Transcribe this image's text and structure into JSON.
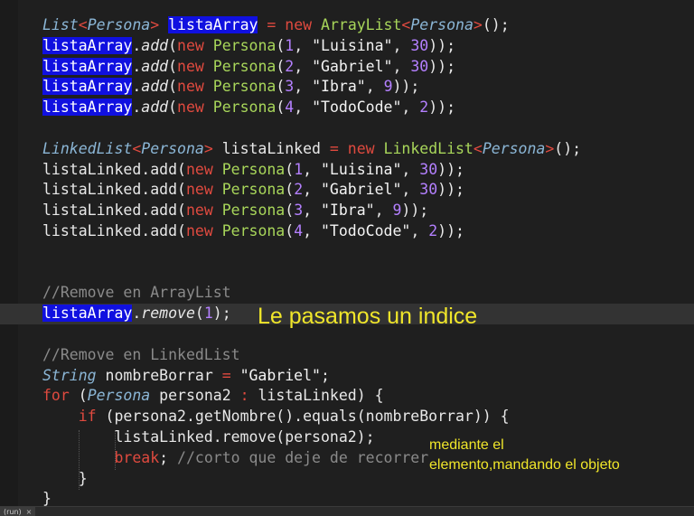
{
  "editor": {
    "highlight_color": "#1010e0",
    "lines": [
      [
        {
          "t": "List",
          "c": "type"
        },
        {
          "t": "<",
          "c": "op"
        },
        {
          "t": "Persona",
          "c": "type"
        },
        {
          "t": ">",
          "c": "op"
        },
        {
          "t": " ",
          "c": "plain"
        },
        {
          "t": "listaArray",
          "c": "hl"
        },
        {
          "t": " ",
          "c": "plain"
        },
        {
          "t": "=",
          "c": "op"
        },
        {
          "t": " ",
          "c": "plain"
        },
        {
          "t": "new",
          "c": "kw"
        },
        {
          "t": " ",
          "c": "plain"
        },
        {
          "t": "ArrayList",
          "c": "cls"
        },
        {
          "t": "<",
          "c": "op"
        },
        {
          "t": "Persona",
          "c": "type"
        },
        {
          "t": ">",
          "c": "op"
        },
        {
          "t": "();",
          "c": "plain"
        }
      ],
      [
        {
          "t": "listaArray",
          "c": "hl"
        },
        {
          "t": ".",
          "c": "plain"
        },
        {
          "t": "add",
          "c": "fn"
        },
        {
          "t": "(",
          "c": "plain"
        },
        {
          "t": "new",
          "c": "kw"
        },
        {
          "t": " ",
          "c": "plain"
        },
        {
          "t": "Persona",
          "c": "cls"
        },
        {
          "t": "(",
          "c": "plain"
        },
        {
          "t": "1",
          "c": "num"
        },
        {
          "t": ", ",
          "c": "plain"
        },
        {
          "t": "\"Luisina\"",
          "c": "str"
        },
        {
          "t": ", ",
          "c": "plain"
        },
        {
          "t": "30",
          "c": "num"
        },
        {
          "t": "));",
          "c": "plain"
        }
      ],
      [
        {
          "t": "listaArray",
          "c": "hl"
        },
        {
          "t": ".",
          "c": "plain"
        },
        {
          "t": "add",
          "c": "fn"
        },
        {
          "t": "(",
          "c": "plain"
        },
        {
          "t": "new",
          "c": "kw"
        },
        {
          "t": " ",
          "c": "plain"
        },
        {
          "t": "Persona",
          "c": "cls"
        },
        {
          "t": "(",
          "c": "plain"
        },
        {
          "t": "2",
          "c": "num"
        },
        {
          "t": ", ",
          "c": "plain"
        },
        {
          "t": "\"Gabriel\"",
          "c": "str"
        },
        {
          "t": ", ",
          "c": "plain"
        },
        {
          "t": "30",
          "c": "num"
        },
        {
          "t": "));",
          "c": "plain"
        }
      ],
      [
        {
          "t": "listaArray",
          "c": "hl"
        },
        {
          "t": ".",
          "c": "plain"
        },
        {
          "t": "add",
          "c": "fn"
        },
        {
          "t": "(",
          "c": "plain"
        },
        {
          "t": "new",
          "c": "kw"
        },
        {
          "t": " ",
          "c": "plain"
        },
        {
          "t": "Persona",
          "c": "cls"
        },
        {
          "t": "(",
          "c": "plain"
        },
        {
          "t": "3",
          "c": "num"
        },
        {
          "t": ", ",
          "c": "plain"
        },
        {
          "t": "\"Ibra\"",
          "c": "str"
        },
        {
          "t": ", ",
          "c": "plain"
        },
        {
          "t": "9",
          "c": "num"
        },
        {
          "t": "));",
          "c": "plain"
        }
      ],
      [
        {
          "t": "listaArray",
          "c": "hl"
        },
        {
          "t": ".",
          "c": "plain"
        },
        {
          "t": "add",
          "c": "fn"
        },
        {
          "t": "(",
          "c": "plain"
        },
        {
          "t": "new",
          "c": "kw"
        },
        {
          "t": " ",
          "c": "plain"
        },
        {
          "t": "Persona",
          "c": "cls"
        },
        {
          "t": "(",
          "c": "plain"
        },
        {
          "t": "4",
          "c": "num"
        },
        {
          "t": ", ",
          "c": "plain"
        },
        {
          "t": "\"TodoCode\"",
          "c": "str"
        },
        {
          "t": ", ",
          "c": "plain"
        },
        {
          "t": "2",
          "c": "num"
        },
        {
          "t": "));",
          "c": "plain"
        }
      ],
      [],
      [
        {
          "t": "LinkedList",
          "c": "type"
        },
        {
          "t": "<",
          "c": "op"
        },
        {
          "t": "Persona",
          "c": "type"
        },
        {
          "t": ">",
          "c": "op"
        },
        {
          "t": " listaLinked ",
          "c": "plain"
        },
        {
          "t": "=",
          "c": "op"
        },
        {
          "t": " ",
          "c": "plain"
        },
        {
          "t": "new",
          "c": "kw"
        },
        {
          "t": " ",
          "c": "plain"
        },
        {
          "t": "LinkedList",
          "c": "cls"
        },
        {
          "t": "<",
          "c": "op"
        },
        {
          "t": "Persona",
          "c": "type"
        },
        {
          "t": ">",
          "c": "op"
        },
        {
          "t": "();",
          "c": "plain"
        }
      ],
      [
        {
          "t": "listaLinked.add(",
          "c": "plain"
        },
        {
          "t": "new",
          "c": "kw"
        },
        {
          "t": " ",
          "c": "plain"
        },
        {
          "t": "Persona",
          "c": "cls"
        },
        {
          "t": "(",
          "c": "plain"
        },
        {
          "t": "1",
          "c": "num"
        },
        {
          "t": ", ",
          "c": "plain"
        },
        {
          "t": "\"Luisina\"",
          "c": "str"
        },
        {
          "t": ", ",
          "c": "plain"
        },
        {
          "t": "30",
          "c": "num"
        },
        {
          "t": "));",
          "c": "plain"
        }
      ],
      [
        {
          "t": "listaLinked.add(",
          "c": "plain"
        },
        {
          "t": "new",
          "c": "kw"
        },
        {
          "t": " ",
          "c": "plain"
        },
        {
          "t": "Persona",
          "c": "cls"
        },
        {
          "t": "(",
          "c": "plain"
        },
        {
          "t": "2",
          "c": "num"
        },
        {
          "t": ", ",
          "c": "plain"
        },
        {
          "t": "\"Gabriel\"",
          "c": "str"
        },
        {
          "t": ", ",
          "c": "plain"
        },
        {
          "t": "30",
          "c": "num"
        },
        {
          "t": "));",
          "c": "plain"
        }
      ],
      [
        {
          "t": "listaLinked.add(",
          "c": "plain"
        },
        {
          "t": "new",
          "c": "kw"
        },
        {
          "t": " ",
          "c": "plain"
        },
        {
          "t": "Persona",
          "c": "cls"
        },
        {
          "t": "(",
          "c": "plain"
        },
        {
          "t": "3",
          "c": "num"
        },
        {
          "t": ", ",
          "c": "plain"
        },
        {
          "t": "\"Ibra\"",
          "c": "str"
        },
        {
          "t": ", ",
          "c": "plain"
        },
        {
          "t": "9",
          "c": "num"
        },
        {
          "t": "));",
          "c": "plain"
        }
      ],
      [
        {
          "t": "listaLinked.add(",
          "c": "plain"
        },
        {
          "t": "new",
          "c": "kw"
        },
        {
          "t": " ",
          "c": "plain"
        },
        {
          "t": "Persona",
          "c": "cls"
        },
        {
          "t": "(",
          "c": "plain"
        },
        {
          "t": "4",
          "c": "num"
        },
        {
          "t": ", ",
          "c": "plain"
        },
        {
          "t": "\"TodoCode\"",
          "c": "str"
        },
        {
          "t": ", ",
          "c": "plain"
        },
        {
          "t": "2",
          "c": "num"
        },
        {
          "t": "));",
          "c": "plain"
        }
      ],
      [],
      [],
      [
        {
          "t": "//Remove en ArrayList",
          "c": "cmt"
        }
      ],
      [
        {
          "t": "listaArray",
          "c": "hl"
        },
        {
          "t": ".",
          "c": "plain"
        },
        {
          "t": "remove",
          "c": "fn"
        },
        {
          "t": "(",
          "c": "plain"
        },
        {
          "t": "1",
          "c": "num"
        },
        {
          "t": ");",
          "c": "plain"
        }
      ],
      [],
      [
        {
          "t": "//Remove en LinkedList",
          "c": "cmt"
        }
      ],
      [
        {
          "t": "String",
          "c": "type"
        },
        {
          "t": " nombreBorrar ",
          "c": "plain"
        },
        {
          "t": "=",
          "c": "op"
        },
        {
          "t": " ",
          "c": "plain"
        },
        {
          "t": "\"Gabriel\"",
          "c": "str"
        },
        {
          "t": ";",
          "c": "plain"
        }
      ],
      [
        {
          "t": "for",
          "c": "kw"
        },
        {
          "t": " (",
          "c": "plain"
        },
        {
          "t": "Persona",
          "c": "type"
        },
        {
          "t": " persona2 ",
          "c": "plain"
        },
        {
          "t": ":",
          "c": "op"
        },
        {
          "t": " listaLinked) {",
          "c": "plain"
        }
      ],
      [
        {
          "t": "    ",
          "c": "plain"
        },
        {
          "t": "if",
          "c": "kw"
        },
        {
          "t": " (persona2.getNombre().equals(nombreBorrar)) {",
          "c": "plain"
        }
      ],
      [
        {
          "t": "        listaLinked.remove(persona2);",
          "c": "plain"
        }
      ],
      [
        {
          "t": "        ",
          "c": "plain"
        },
        {
          "t": "break",
          "c": "kw"
        },
        {
          "t": "; ",
          "c": "plain"
        },
        {
          "t": "//corto que deje de recorrer",
          "c": "cmt"
        }
      ],
      [
        {
          "t": "    }",
          "c": "plain"
        }
      ],
      [
        {
          "t": "}",
          "c": "plain"
        }
      ]
    ]
  },
  "annotations": {
    "main": "Le pasamos un indice",
    "secondary_line1": "mediante el",
    "secondary_line2": "elemento,mandando el objeto"
  },
  "tab": {
    "label": "(run)",
    "close_glyph": "×"
  }
}
